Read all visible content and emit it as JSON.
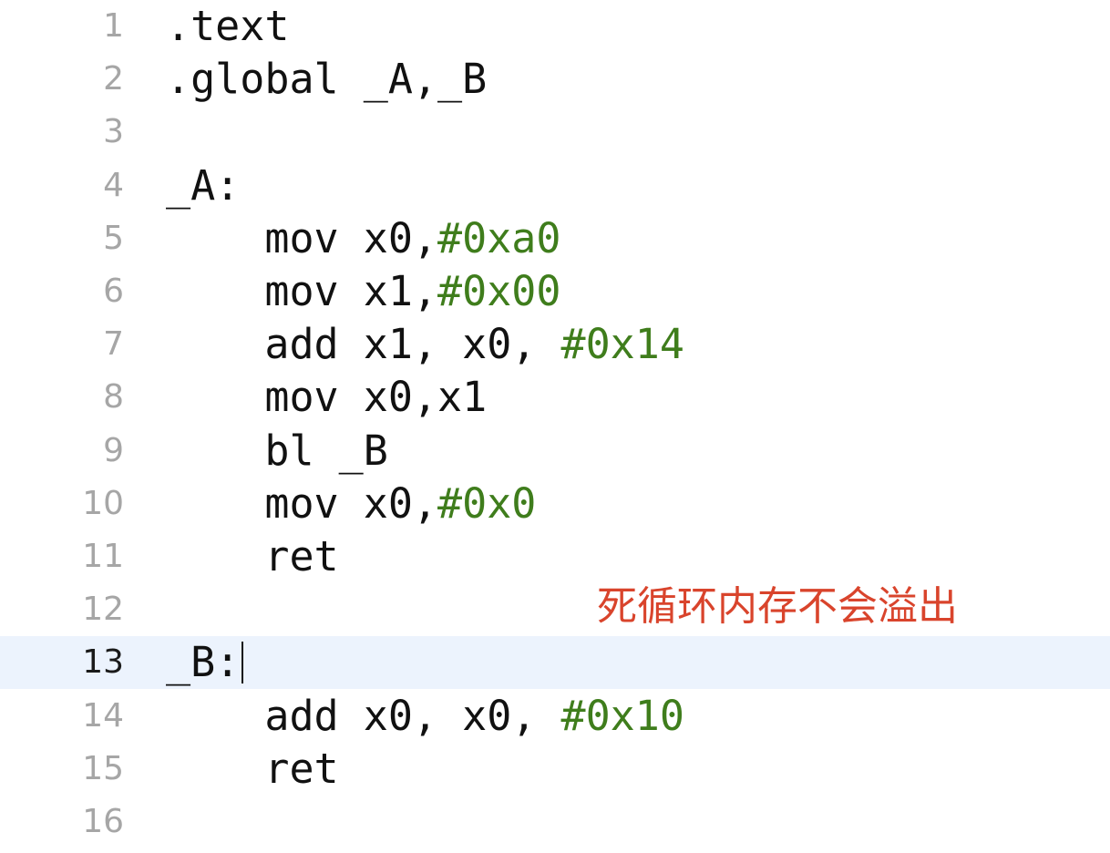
{
  "editor": {
    "current_line": 13,
    "colors": {
      "background": "#ffffff",
      "current_line_highlight": "#ecf3fd",
      "line_number": "#a6a6a6",
      "text": "#111111",
      "number_literal": "#3f7d1c",
      "annotation": "#d9442c"
    },
    "lines": [
      {
        "n": "1",
        "indent": "",
        "tokens": [
          {
            "t": ".text",
            "k": "plain"
          }
        ]
      },
      {
        "n": "2",
        "indent": "",
        "tokens": [
          {
            "t": ".global _A,_B",
            "k": "plain"
          }
        ]
      },
      {
        "n": "3",
        "indent": "",
        "tokens": []
      },
      {
        "n": "4",
        "indent": "",
        "tokens": [
          {
            "t": "_A:",
            "k": "plain"
          }
        ]
      },
      {
        "n": "5",
        "indent": "    ",
        "tokens": [
          {
            "t": "mov x0,",
            "k": "plain"
          },
          {
            "t": "#0xa0",
            "k": "num"
          }
        ]
      },
      {
        "n": "6",
        "indent": "    ",
        "tokens": [
          {
            "t": "mov x1,",
            "k": "plain"
          },
          {
            "t": "#0x00",
            "k": "num"
          }
        ]
      },
      {
        "n": "7",
        "indent": "    ",
        "tokens": [
          {
            "t": "add x1, x0, ",
            "k": "plain"
          },
          {
            "t": "#0x14",
            "k": "num"
          }
        ]
      },
      {
        "n": "8",
        "indent": "    ",
        "tokens": [
          {
            "t": "mov x0,x1",
            "k": "plain"
          }
        ]
      },
      {
        "n": "9",
        "indent": "    ",
        "tokens": [
          {
            "t": "bl _B",
            "k": "plain"
          }
        ]
      },
      {
        "n": "10",
        "indent": "    ",
        "tokens": [
          {
            "t": "mov x0,",
            "k": "plain"
          },
          {
            "t": "#0x0",
            "k": "num"
          }
        ]
      },
      {
        "n": "11",
        "indent": "    ",
        "tokens": [
          {
            "t": "ret",
            "k": "plain"
          }
        ]
      },
      {
        "n": "12",
        "indent": "",
        "tokens": []
      },
      {
        "n": "13",
        "indent": "",
        "tokens": [
          {
            "t": "_B:",
            "k": "plain"
          }
        ],
        "caret": true
      },
      {
        "n": "14",
        "indent": "    ",
        "tokens": [
          {
            "t": "add x0, x0, ",
            "k": "plain"
          },
          {
            "t": "#0x10",
            "k": "num"
          }
        ]
      },
      {
        "n": "15",
        "indent": "    ",
        "tokens": [
          {
            "t": "ret",
            "k": "plain"
          }
        ]
      },
      {
        "n": "16",
        "indent": "",
        "tokens": []
      }
    ]
  },
  "annotation": {
    "text": "死循环内存不会溢出"
  }
}
